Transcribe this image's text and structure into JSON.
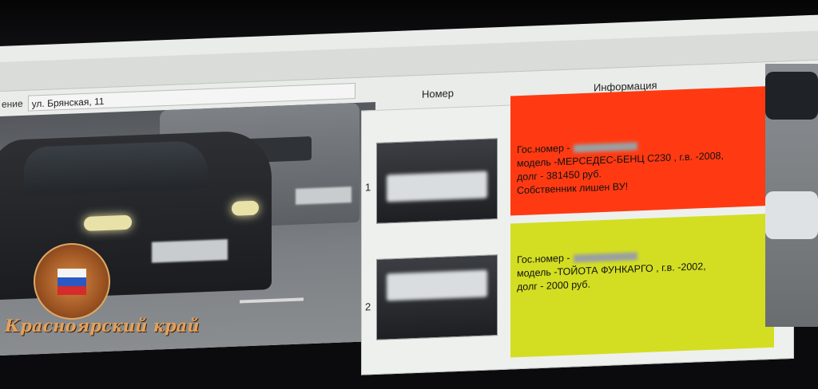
{
  "app": {
    "location_label": "ение",
    "location_value": "ул. Брянская, 11"
  },
  "table": {
    "headers": {
      "number": "Номер",
      "info": "Информация"
    },
    "rows": [
      {
        "index": "1",
        "status_color": "#ff3a12",
        "lines": [
          "Гос.номер -",
          "модель -МЕРСЕДЕС-БЕНЦ С230  , г.в. -2008,",
          "долг - 381450 руб.",
          "Собственник лишен ВУ!"
        ]
      },
      {
        "index": "2",
        "status_color": "#d3de22",
        "lines": [
          "Гос.номер -",
          "модель -ТОЙОТА ФУНКАРГО  , г.в. -2002,",
          "долг - 2000 руб."
        ]
      }
    ]
  },
  "watermark": {
    "caption": "Красноярский край",
    "icon": "police-emblem-icon"
  }
}
